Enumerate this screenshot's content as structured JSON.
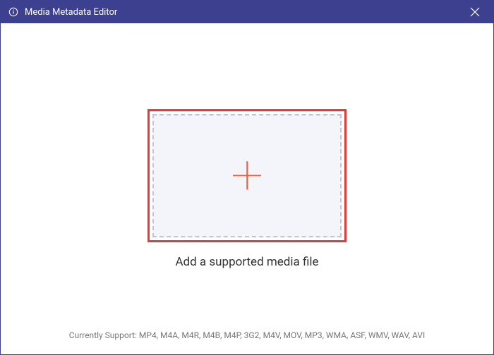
{
  "window": {
    "title": "Media Metadata Editor"
  },
  "main": {
    "dropzone_label": "Add a supported media file"
  },
  "footer": {
    "support_text": "Currently Support: MP4, M4A, M4R, M4B, M4P, 3G2, M4V, MOV, MP3, WMA, ASF, WMV, WAV, AVI"
  }
}
